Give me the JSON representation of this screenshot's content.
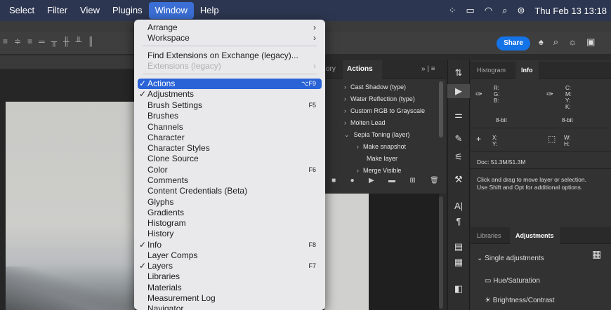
{
  "menubar": {
    "items": [
      "Select",
      "Filter",
      "View",
      "Plugins",
      "Window",
      "Help"
    ],
    "active": "Window",
    "clock": "Thu Feb 13  13:18"
  },
  "toolbar": {
    "share_label": "Share"
  },
  "actions_panel": {
    "tab_history": "ory",
    "tab_actions": "Actions",
    "rows": [
      {
        "chev": "›",
        "label": "Cast Shadow (type)"
      },
      {
        "chev": "›",
        "label": "Water Reflection (type)"
      },
      {
        "chev": "›",
        "label": "Custom RGB to Grayscale"
      },
      {
        "chev": "›",
        "label": "Molten Lead"
      },
      {
        "chev": "⌄",
        "label": "Sepia Toning (layer)"
      },
      {
        "chev": "›",
        "label": "Make snapshot"
      },
      {
        "chev": "",
        "label": "Make layer"
      },
      {
        "chev": "›",
        "label": "Merge Visible"
      }
    ]
  },
  "info_panel": {
    "tab_histogram": "Histogram",
    "tab_info": "Info",
    "rgb_labels": "R:\nG:\nB:",
    "cmyk_labels": "C:\nM:\nY:\nK:",
    "bit_left": "8-bit",
    "bit_right": "8-bit",
    "xy_labels": "X:\nY:",
    "wh_labels": "W:\nH:",
    "doc_size": "Doc: 51.3M/51.3M",
    "hint_line1": "Click and drag to move layer or selection.",
    "hint_line2": "Use Shift and Opt for additional options."
  },
  "adjust_panel": {
    "tab_libraries": "Libraries",
    "tab_adjustments": "Adjustments",
    "section": "Single adjustments",
    "items": [
      "Hue/Saturation",
      "Brightness/Contrast"
    ]
  },
  "window_menu": {
    "items": [
      {
        "label": "Arrange",
        "arrow": true
      },
      {
        "label": "Workspace",
        "arrow": true
      },
      {
        "label": "Find Extensions on Exchange (legacy)..."
      },
      {
        "label": "Extensions (legacy)",
        "arrow": true,
        "disabled": true
      },
      {
        "label": "Actions",
        "checked": true,
        "shortcut": "⌥F9",
        "highlighted": true
      },
      {
        "label": "Adjustments",
        "checked": true
      },
      {
        "label": "Brush Settings",
        "shortcut": "F5"
      },
      {
        "label": "Brushes"
      },
      {
        "label": "Channels"
      },
      {
        "label": "Character"
      },
      {
        "label": "Character Styles"
      },
      {
        "label": "Clone Source"
      },
      {
        "label": "Color",
        "shortcut": "F6"
      },
      {
        "label": "Comments"
      },
      {
        "label": "Content Credentials (Beta)"
      },
      {
        "label": "Glyphs"
      },
      {
        "label": "Gradients"
      },
      {
        "label": "Histogram"
      },
      {
        "label": "History"
      },
      {
        "label": "Info",
        "checked": true,
        "shortcut": "F8"
      },
      {
        "label": "Layer Comps"
      },
      {
        "label": "Layers",
        "checked": true,
        "shortcut": "F7"
      },
      {
        "label": "Libraries"
      },
      {
        "label": "Materials"
      },
      {
        "label": "Measurement Log"
      },
      {
        "label": "Navigator"
      }
    ]
  }
}
